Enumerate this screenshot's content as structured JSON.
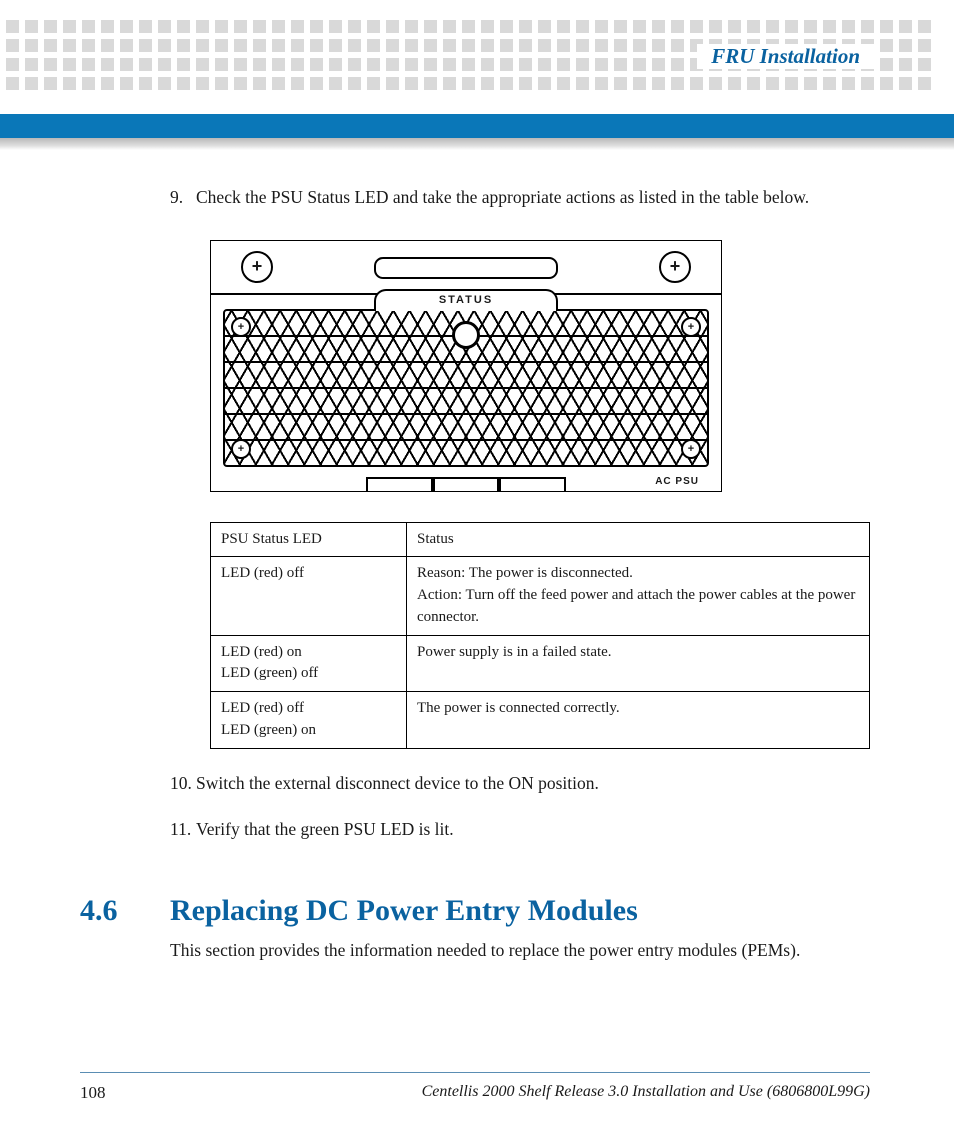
{
  "header": {
    "title": "FRU Installation"
  },
  "steps": {
    "s9_num": "9.",
    "s9_text": "Check the PSU Status  LED and take the appropriate actions as listed in the table below.",
    "s10_num": "10.",
    "s10_text": "Switch the external disconnect device to the ON position.",
    "s11_num": "11.",
    "s11_text": "Verify that the green PSU LED is lit."
  },
  "figure": {
    "status_label": "STATUS",
    "bottom_label": "AC PSU"
  },
  "table": {
    "h1": "PSU Status LED",
    "h2": "Status",
    "r1c1": "LED (red) off",
    "r1c2a": "Reason: The power is disconnected.",
    "r1c2b": "Action: Turn off the feed power and attach the power cables at the power connector.",
    "r2c1a": "LED (red) on",
    "r2c1b": "LED (green) off",
    "r2c2": "Power supply is in a failed state.",
    "r3c1a": "LED (red) off",
    "r3c1b": "LED (green) on",
    "r3c2": "The power is connected correctly."
  },
  "section": {
    "num": "4.6",
    "title": "Replacing DC Power Entry Modules",
    "body": "This section provides the information needed to replace the power entry modules (PEMs)."
  },
  "footer": {
    "page": "108",
    "doc": "Centellis 2000 Shelf Release 3.0 Installation and Use (6806800L99G)"
  }
}
